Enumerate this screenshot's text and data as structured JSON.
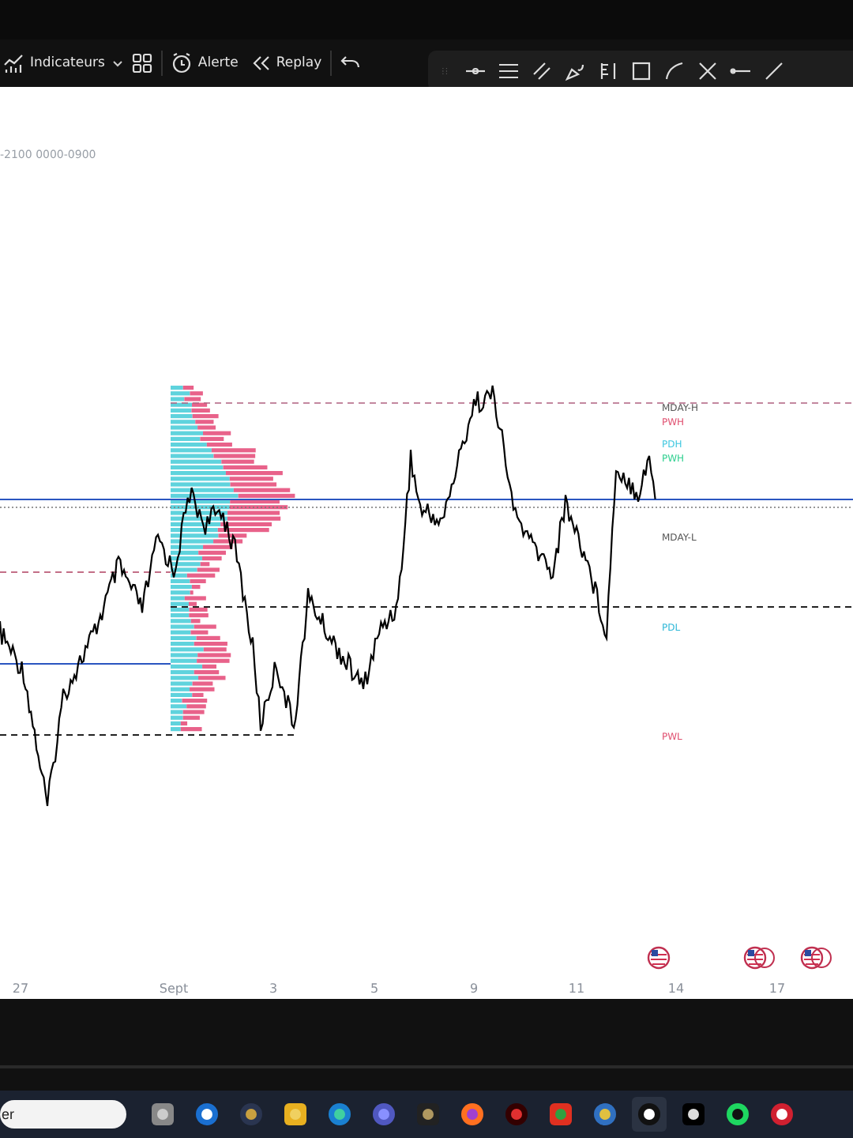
{
  "toolbar": {
    "items": [
      {
        "kind": "indicators",
        "label": "Indicateurs"
      },
      {
        "kind": "layout"
      },
      {
        "kind": "alert",
        "label": "Alerte"
      },
      {
        "kind": "replay",
        "label": "Replay"
      },
      {
        "kind": "undo"
      }
    ]
  },
  "session_label": "-2100 0000-0900",
  "levels": [
    {
      "label": "MDAY-H",
      "color": "#555555"
    },
    {
      "label": "PWH",
      "color": "#e05070"
    },
    {
      "label": "PDH",
      "color": "#40c8e0"
    },
    {
      "label": "PWH",
      "color": "#30d090"
    },
    {
      "label": "MDAY-L",
      "color": "#555555"
    },
    {
      "label": "PDL",
      "color": "#30b8d8"
    },
    {
      "label": "PWL",
      "color": "#e05070"
    }
  ],
  "x_axis": [
    "27",
    "Sept",
    "3",
    "5",
    "9",
    "11",
    "14",
    "17"
  ],
  "taskbar": {
    "search": {
      "placeholder": "er"
    }
  }
}
